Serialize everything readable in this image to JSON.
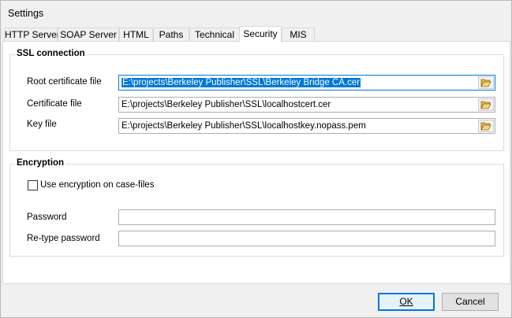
{
  "window": {
    "title": "Settings"
  },
  "tabs": [
    {
      "label": "HTTP Server"
    },
    {
      "label": "SOAP Server"
    },
    {
      "label": "HTML"
    },
    {
      "label": "Paths"
    },
    {
      "label": "Technical"
    },
    {
      "label": "Security"
    },
    {
      "label": "MIS"
    }
  ],
  "active_tab": "Security",
  "ssl": {
    "title": "SSL connection",
    "root_cert": {
      "label": "Root certificate file",
      "value": "E:\\projects\\Berkeley Publisher\\SSL\\Berkeley Bridge CA.cer"
    },
    "cert": {
      "label": "Certificate file",
      "value": "E:\\projects\\Berkeley Publisher\\SSL\\localhostcert.cer"
    },
    "key": {
      "label": "Key file",
      "value": "E:\\projects\\Berkeley Publisher\\SSL\\localhostkey.nopass.pem"
    },
    "browse_icon": "folder-open-icon"
  },
  "encryption": {
    "title": "Encryption",
    "checkbox_label": "Use encryption on case-files",
    "checked": false,
    "password_label": "Password",
    "password_value": "",
    "retype_label": "Re-type password",
    "retype_value": ""
  },
  "buttons": {
    "ok": "OK",
    "cancel": "Cancel"
  },
  "colors": {
    "accent": "#0078d7",
    "folder": "#e8b84a"
  }
}
